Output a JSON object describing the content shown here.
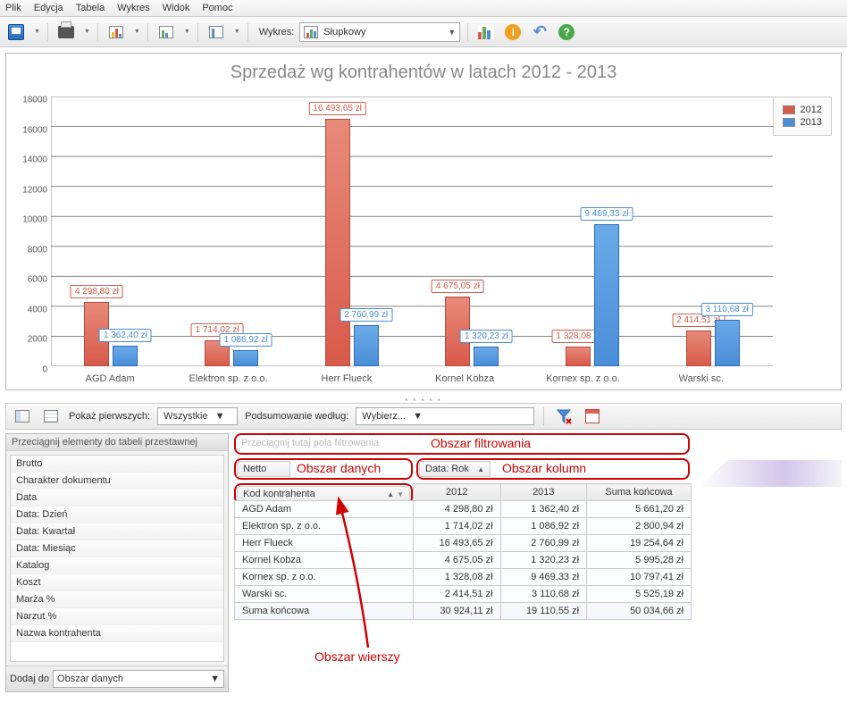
{
  "menu": [
    "Plik",
    "Edycja",
    "Tabela",
    "Wykres",
    "Widok",
    "Pomoc"
  ],
  "toolbar": {
    "chart_label": "Wykres:",
    "chart_type": "Słupkowy"
  },
  "chart_data": {
    "type": "bar",
    "title": "Sprzedaż wg kontrahentów w latach 2012 - 2013",
    "categories": [
      "AGD Adam",
      "Elektron sp. z o.o.",
      "Herr Flueck",
      "Kornel Kobza",
      "Kornex sp. z o.o.",
      "Warski sc."
    ],
    "series": [
      {
        "name": "2012",
        "color": "#d85a4a",
        "values": [
          4298.8,
          1714.02,
          16493.65,
          4675.05,
          1328.08,
          2414.51
        ],
        "labels": [
          "4 298,80 zł",
          "1 714,02 zł",
          "16 493,65 zł",
          "4 675,05 zł",
          "1 328,08 zł",
          "2 414,51 zł"
        ]
      },
      {
        "name": "2013",
        "color": "#4a8ed8",
        "values": [
          1362.4,
          1086.92,
          2760.99,
          1320.23,
          9469.33,
          3110.68
        ],
        "labels": [
          "1 362,40 zł",
          "1 086,92 zł",
          "2 760,99 zł",
          "1 320,23 zł",
          "9 469,33 zł",
          "3 110,68 zł"
        ]
      }
    ],
    "ylim": [
      0,
      18000
    ],
    "yticks": [
      0,
      2000,
      4000,
      6000,
      8000,
      10000,
      12000,
      14000,
      16000,
      18000
    ]
  },
  "pivot_toolbar": {
    "show_first": "Pokaż pierwszych:",
    "show_first_val": "Wszystkie",
    "summary_by": "Podsumowanie według:",
    "summary_val": "Wybierz..."
  },
  "fieldlist": {
    "header": "Przeciągnij elementy do tabeli przestawnej",
    "items": [
      "Brutto",
      "Charakter dokumentu",
      "Data",
      "Data: Dzień",
      "Data: Kwartał",
      "Data: Miesiąc",
      "Katalog",
      "Koszt",
      "Marża %",
      "Narzut %",
      "Nazwa kontrahenta"
    ],
    "add_to": "Dodaj do",
    "add_target": "Obszar danych"
  },
  "pivot": {
    "filter_hint": "Przeciągnij tutaj pola filtrowania",
    "data_field": "Netto",
    "col_field": "Data: Rok",
    "row_field": "Kod kontrahenta",
    "col_headers": [
      "2012",
      "2013",
      "Suma końcowa"
    ],
    "rows": [
      {
        "label": "AGD Adam",
        "vals": [
          "4 298,80 zł",
          "1 362,40 zł",
          "5 661,20 zł"
        ]
      },
      {
        "label": "Elektron sp. z o.o.",
        "vals": [
          "1 714,02 zł",
          "1 086,92 zł",
          "2 800,94 zł"
        ]
      },
      {
        "label": "Herr Flueck",
        "vals": [
          "16 493,65 zł",
          "2 760,99 zł",
          "19 254,64 zł"
        ]
      },
      {
        "label": "Kornel Kobza",
        "vals": [
          "4 675,05 zł",
          "1 320,23 zł",
          "5 995,28 zł"
        ]
      },
      {
        "label": "Kornex sp. z o.o.",
        "vals": [
          "1 328,08 zł",
          "9 469,33 zł",
          "10 797,41 zł"
        ]
      },
      {
        "label": "Warski sc.",
        "vals": [
          "2 414,51 zł",
          "3 110,68 zł",
          "5 525,19 zł"
        ]
      }
    ],
    "total": {
      "label": "Suma końcowa",
      "vals": [
        "30 924,11 zł",
        "19 110,55 zł",
        "50 034,66 zł"
      ]
    }
  },
  "annotations": {
    "filter": "Obszar filtrowania",
    "data": "Obszar danych",
    "cols": "Obszar kolumn",
    "rows": "Obszar wierszy"
  }
}
